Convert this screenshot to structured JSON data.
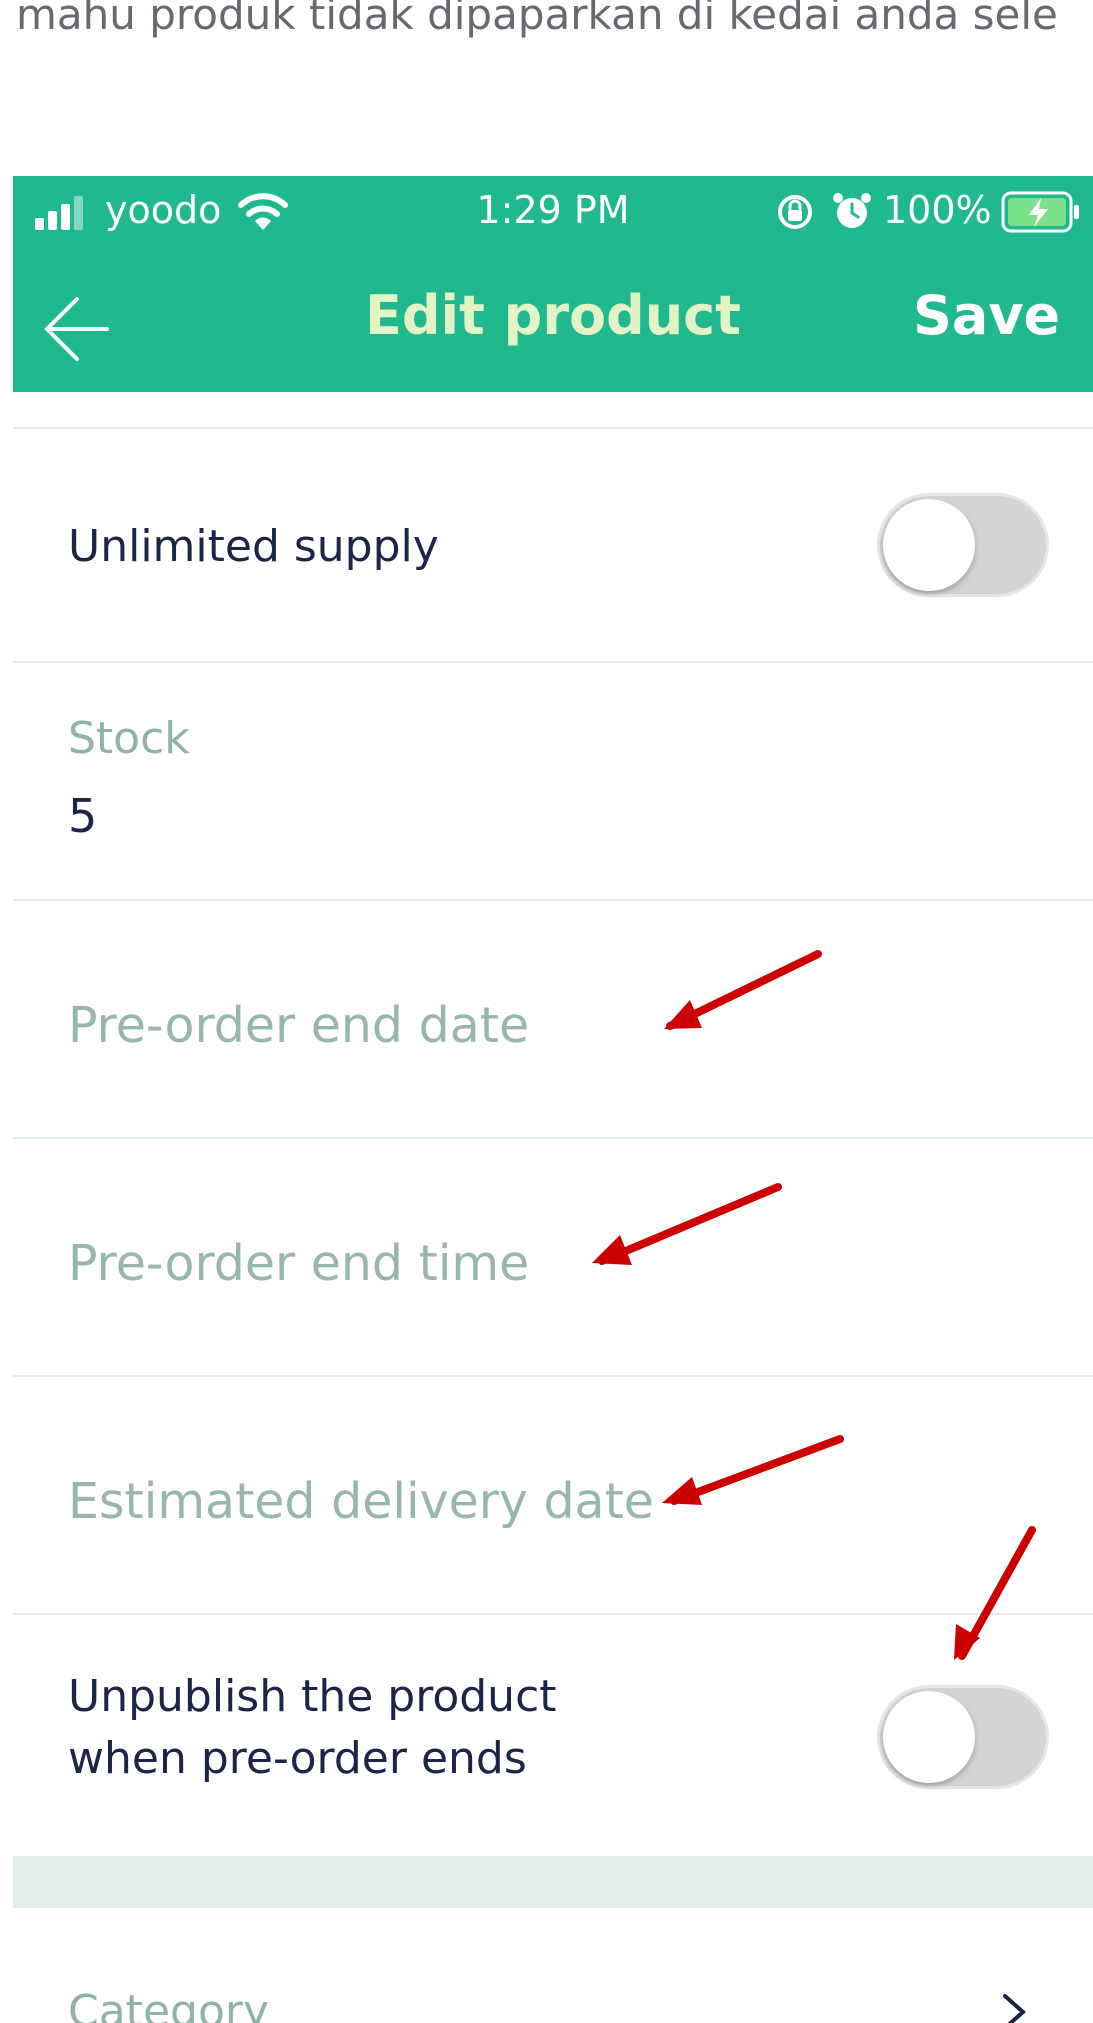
{
  "caption": "mahu produk tidak dipaparkan di kedai anda sele",
  "status_bar": {
    "carrier": "yoodo",
    "time": "1:29 PM",
    "battery": "100%"
  },
  "nav": {
    "title": "Edit product",
    "save_label": "Save"
  },
  "form": {
    "unlimited_supply": {
      "label": "Unlimited supply",
      "enabled": false
    },
    "stock": {
      "label": "Stock",
      "value": "5"
    },
    "preorder_end_date": {
      "placeholder": "Pre-order end date"
    },
    "preorder_end_time": {
      "placeholder": "Pre-order end time"
    },
    "estimated_delivery": {
      "placeholder": "Estimated delivery date"
    },
    "unpublish": {
      "label_line1": "Unpublish the product",
      "label_line2": "when pre-order ends",
      "enabled": false
    },
    "category": {
      "label": "Category"
    }
  },
  "colors": {
    "header": "#20b88e",
    "title": "#e2f4c4",
    "annotation_arrow": "#cc0000"
  },
  "icons": [
    "signal-icon",
    "wifi-icon",
    "rotation-lock-icon",
    "alarm-icon",
    "battery-charging-icon",
    "back-arrow-icon",
    "chevron-right-icon"
  ]
}
